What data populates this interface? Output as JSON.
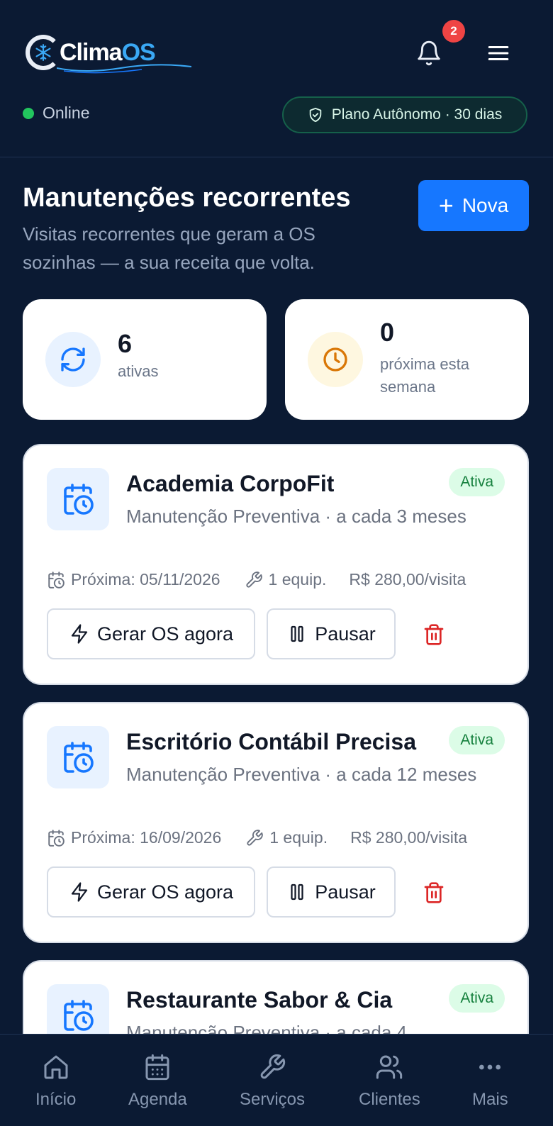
{
  "header": {
    "logo_text_1": "Clima",
    "logo_text_2": "OS",
    "notifications_count": "2",
    "online_label": "Online",
    "plan_label": "Plano Autônomo · 30 dias"
  },
  "page": {
    "title": "Manutenções recorrentes",
    "subtitle": "Visitas recorrentes que geram a OS sozinhas — a sua receita que volta.",
    "new_button": "Nova",
    "new_button_icon": "+"
  },
  "stats": [
    {
      "value": "6",
      "label": "ativas",
      "icon": "refresh-icon"
    },
    {
      "value": "0",
      "label": "próxima esta semana",
      "icon": "clock-icon"
    }
  ],
  "cards": [
    {
      "name": "Academia CorpoFit",
      "service": "Manutenção Preventiva · a cada 3 meses",
      "status": "Ativa",
      "next": "Próxima: 05/11/2026",
      "equip": "1 equip.",
      "price": "R$ 280,00/visita",
      "generate_label": "Gerar OS agora",
      "pause_label": "Pausar"
    },
    {
      "name": "Escritório Contábil Precisa",
      "service": "Manutenção Preventiva · a cada 12 meses",
      "status": "Ativa",
      "next": "Próxima: 16/09/2026",
      "equip": "1 equip.",
      "price": "R$ 280,00/visita",
      "generate_label": "Gerar OS agora",
      "pause_label": "Pausar"
    },
    {
      "name": "Restaurante Sabor & Cia",
      "service": "Manutenção Preventiva · a cada 4",
      "status": "Ativa"
    }
  ],
  "nav": [
    {
      "label": "Início",
      "icon": "home-icon"
    },
    {
      "label": "Agenda",
      "icon": "calendar-icon"
    },
    {
      "label": "Serviços",
      "icon": "wrench-icon"
    },
    {
      "label": "Clientes",
      "icon": "users-icon"
    },
    {
      "label": "Mais",
      "icon": "more-icon"
    }
  ],
  "colors": {
    "background": "#0b1a33",
    "accent": "#1677ff",
    "success": "#22c55e",
    "danger": "#ef4444"
  }
}
